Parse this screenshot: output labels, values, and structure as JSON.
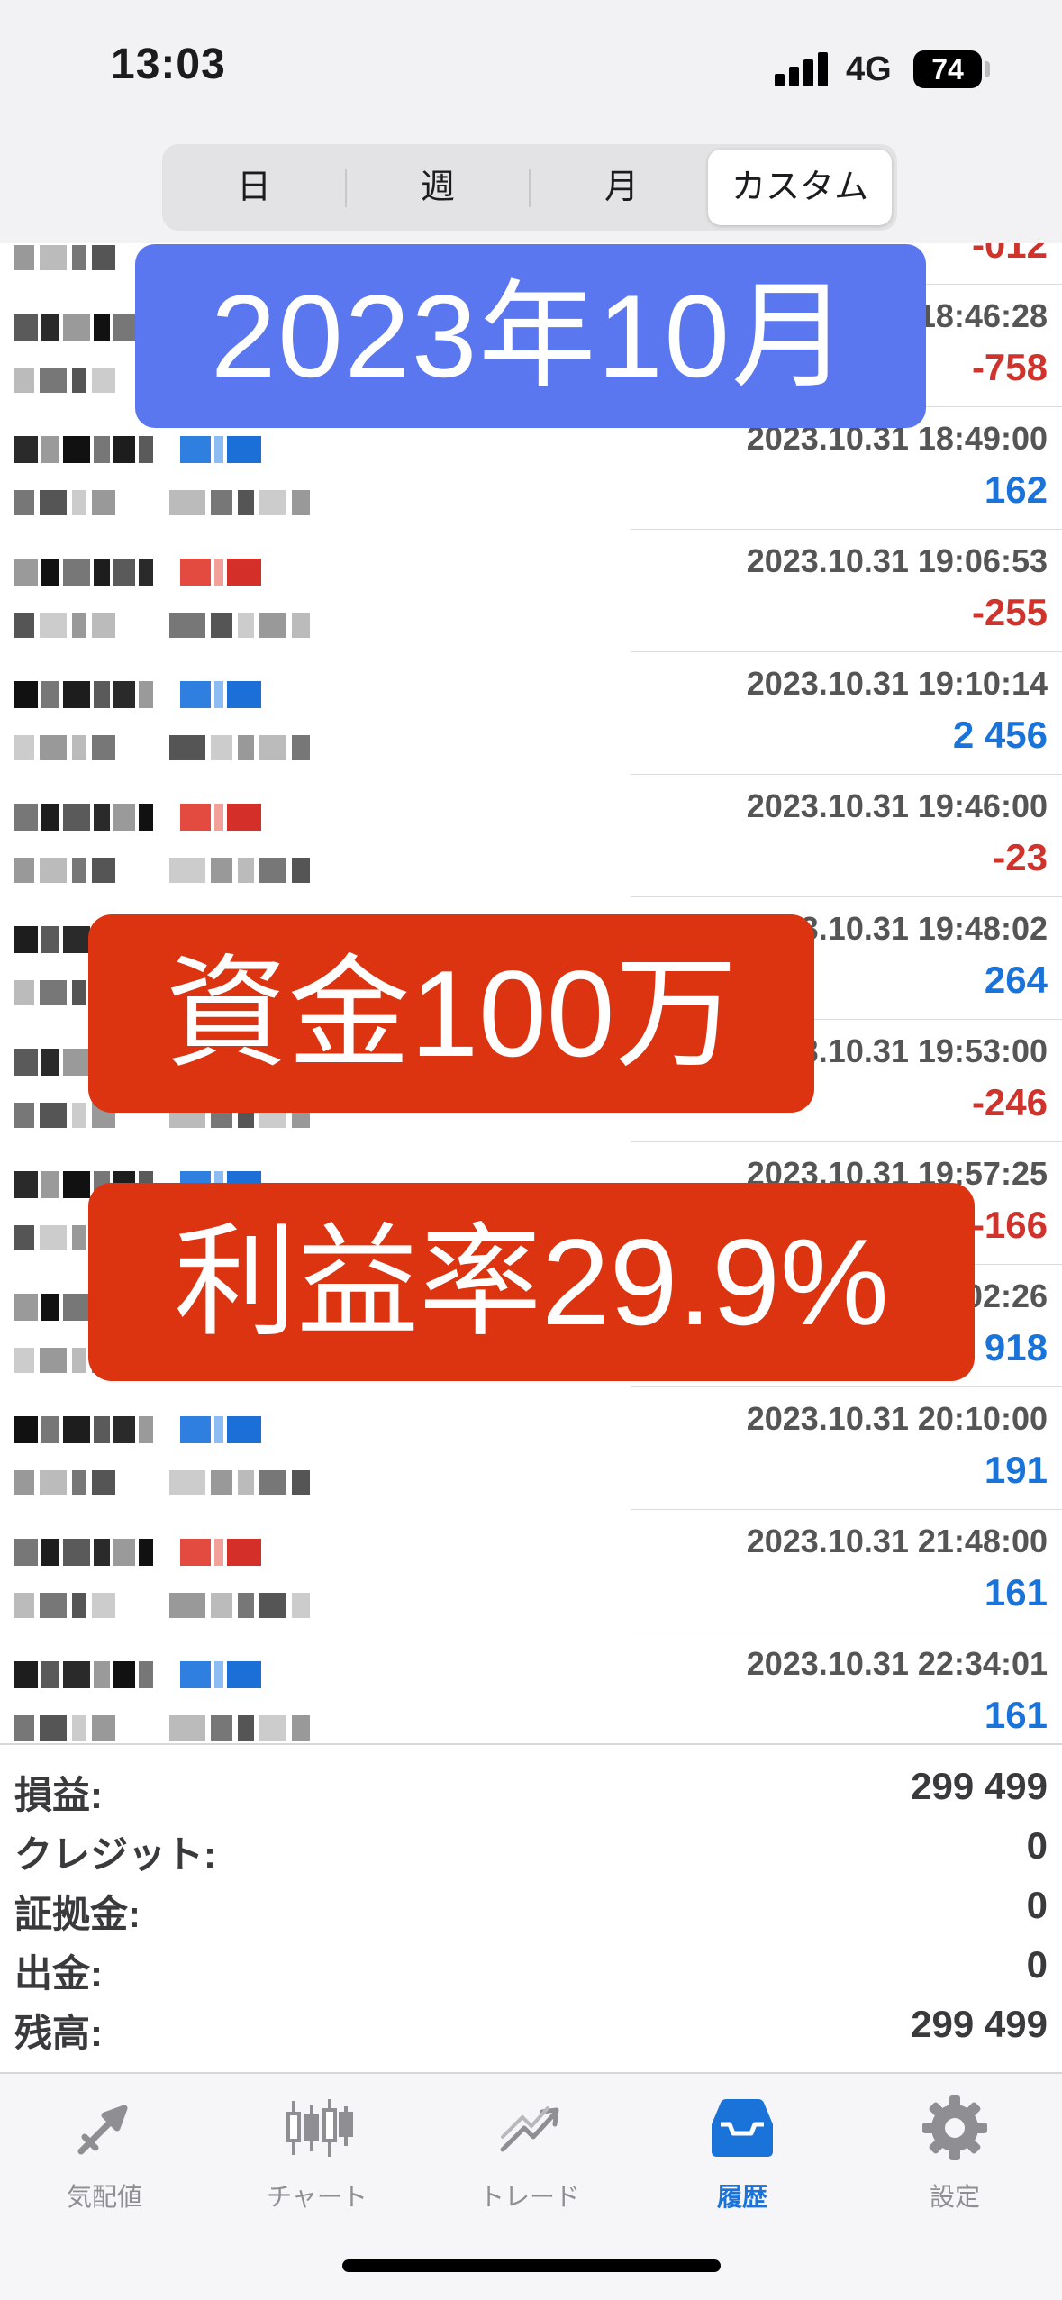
{
  "status": {
    "time": "13:03",
    "network": "4G",
    "battery": "74"
  },
  "segments": [
    "日",
    "週",
    "月",
    "カスタム"
  ],
  "overlays": {
    "month": "2023年10月",
    "capital": "資金100万",
    "rate": "利益率29.9%"
  },
  "trades": [
    {
      "time": "",
      "value": "-012",
      "type": "neg"
    },
    {
      "time": "18:46:28",
      "value": "-758",
      "type": "neg"
    },
    {
      "time": "2023.10.31 18:49:00",
      "value": "162",
      "type": "pos"
    },
    {
      "time": "2023.10.31 19:06:53",
      "value": "-255",
      "type": "neg"
    },
    {
      "time": "2023.10.31 19:10:14",
      "value": "2 456",
      "type": "pos"
    },
    {
      "time": "2023.10.31 19:46:00",
      "value": "-23",
      "type": "neg"
    },
    {
      "time": "2023.10.31 19:48:02",
      "value": "264",
      "type": "pos"
    },
    {
      "time": "2023.10.31 19:53:00",
      "value": "-246",
      "type": "neg"
    },
    {
      "time": "2023.10.31 19:57:25",
      "value": "-166",
      "type": "neg"
    },
    {
      "time": "02:26",
      "value": "918",
      "type": "pos"
    },
    {
      "time": "2023.10.31 20:10:00",
      "value": "191",
      "type": "pos"
    },
    {
      "time": "2023.10.31 21:48:00",
      "value": "161",
      "type": "pos"
    },
    {
      "time": "2023.10.31 22:34:01",
      "value": "161",
      "type": "pos"
    }
  ],
  "summary": [
    {
      "label": "損益:",
      "value": "299 499"
    },
    {
      "label": "クレジット:",
      "value": "0"
    },
    {
      "label": "証拠金:",
      "value": "0"
    },
    {
      "label": "出金:",
      "value": "0"
    },
    {
      "label": "残高:",
      "value": "299 499"
    }
  ],
  "tabs": [
    {
      "label": "気配値",
      "icon": "quotes-icon",
      "active": false
    },
    {
      "label": "チャート",
      "icon": "chart-icon",
      "active": false
    },
    {
      "label": "トレード",
      "icon": "trade-icon",
      "active": false
    },
    {
      "label": "履歴",
      "icon": "history-icon",
      "active": true
    },
    {
      "label": "設定",
      "icon": "gear-icon",
      "active": false
    }
  ],
  "colors": {
    "negative": "#d0322c",
    "positive": "#1a73d9",
    "overlay_blue": "#5b77f0",
    "overlay_red": "#dc3311",
    "accent": "#1a73d9"
  }
}
